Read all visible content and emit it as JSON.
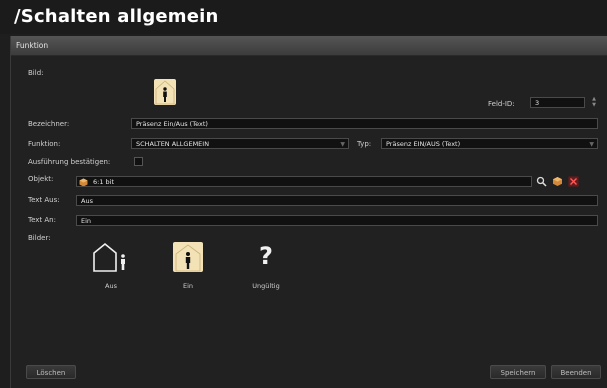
{
  "window": {
    "title": "/Schalten allgemein"
  },
  "panel": {
    "header": "Funktion"
  },
  "labels": {
    "bild": "Bild:",
    "feld_id": "Feld-ID:",
    "bezeichner": "Bezeichner:",
    "funktion": "Funktion:",
    "typ": "Typ:",
    "ausfuehrung": "Ausführung bestätigen:",
    "objekt": "Objekt:",
    "text_aus": "Text Aus:",
    "text_an": "Text An:",
    "bilder": "Bilder:"
  },
  "fields": {
    "feld_id": "3",
    "bezeichner": "Präsenz Ein/Aus (Text)",
    "funktion": "SCHALTEN ALLGEMEIN",
    "typ": "Präsenz EIN/AUS (Text)",
    "objekt": "6:1 bit",
    "text_aus": "Aus",
    "text_an": "Ein"
  },
  "bilder": {
    "aus": "Aus",
    "ein": "Ein",
    "ungueltig": "Ungültig",
    "question_mark": "?"
  },
  "buttons": {
    "loeschen": "Löschen",
    "speichern": "Speichern",
    "beenden": "Beenden"
  },
  "icons": {
    "spinner_up": "▲",
    "spinner_down": "▼",
    "select_arrow": "▼"
  },
  "colors": {
    "house_fill": "#f3e2b5",
    "background": "#1e1e1e",
    "panel_header": "#4a4a4a"
  }
}
